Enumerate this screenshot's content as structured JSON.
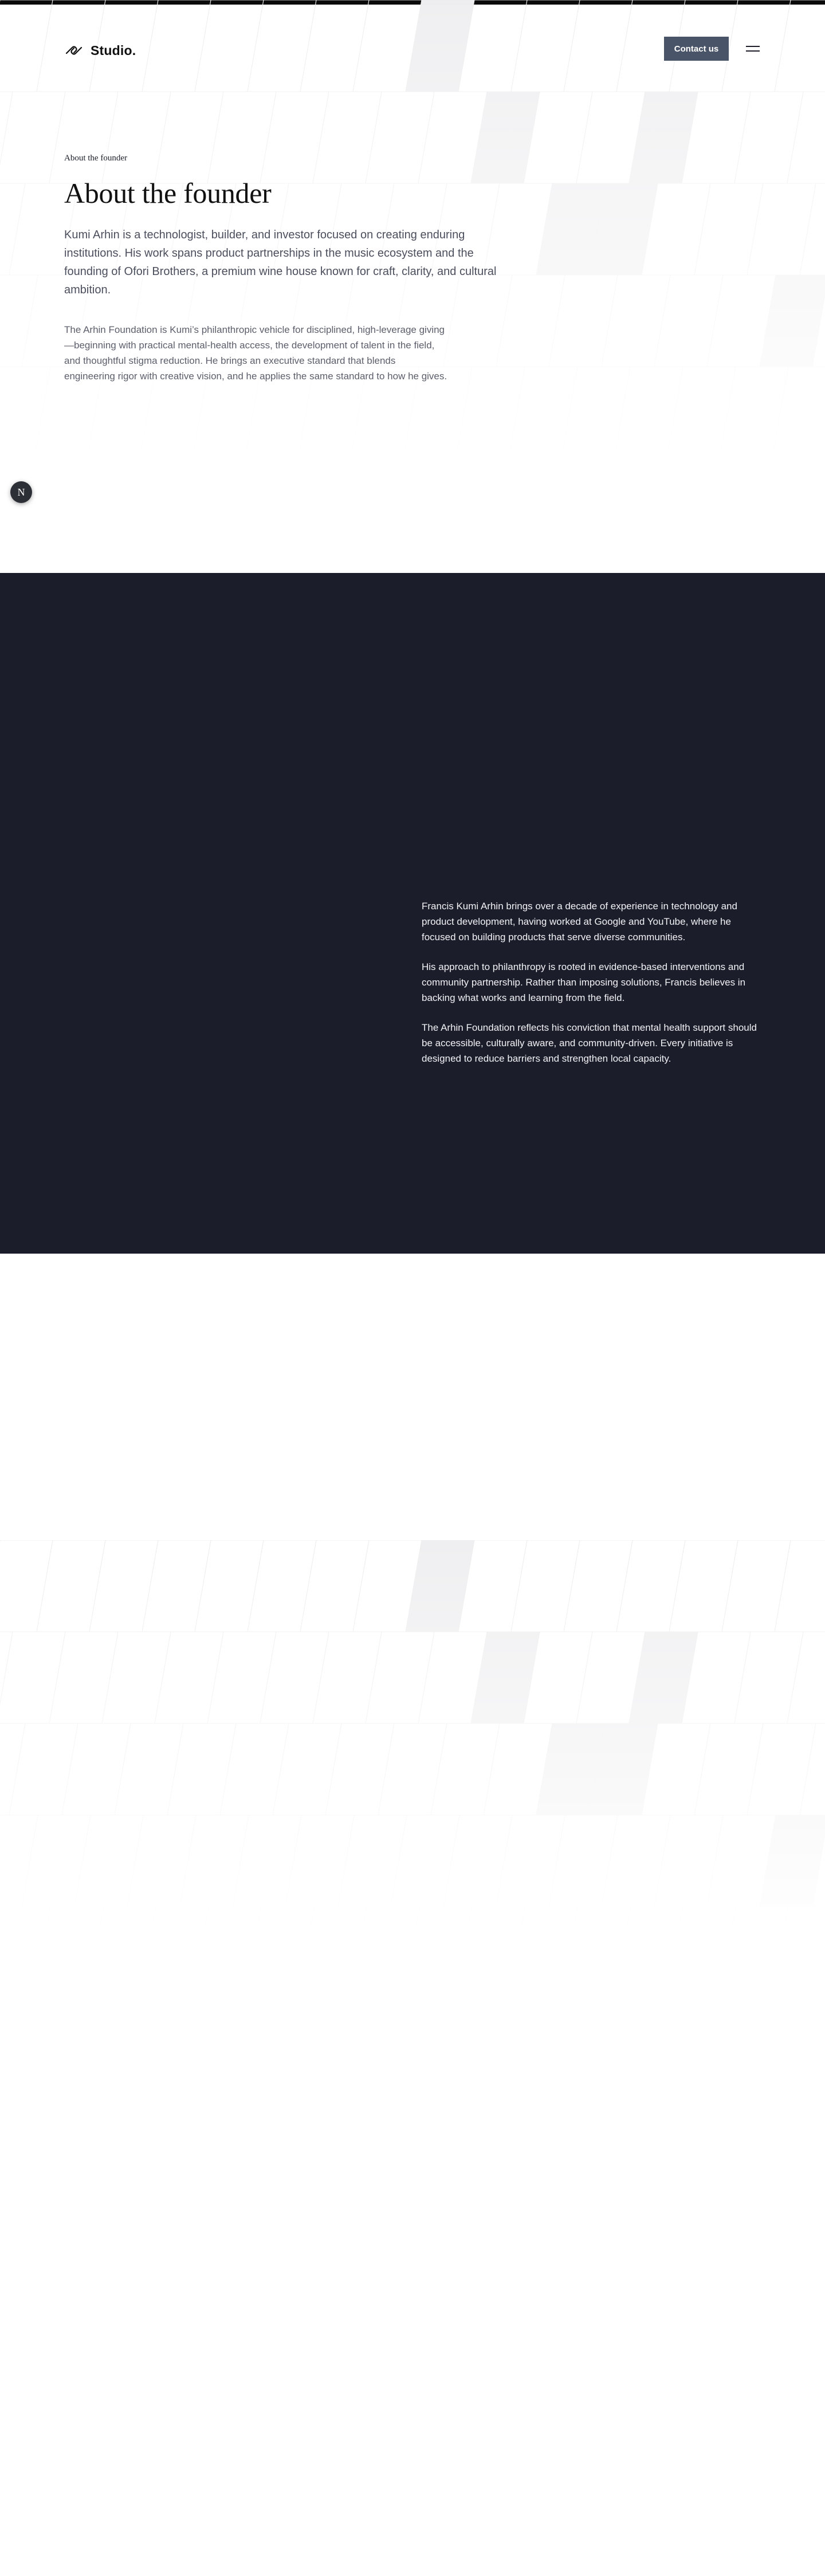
{
  "header": {
    "logo_text": "Studio.",
    "contact_label": "Contact us",
    "menu_icon": "hamburger-icon",
    "logo_icon": "link-icon"
  },
  "about": {
    "eyebrow": "About the founder",
    "title": "About the founder",
    "lead": "Kumi Arhin is a technologist, builder, and investor focused on creating enduring institutions. His work spans product partnerships in the music ecosystem and the founding of Ofori Brothers, a premium wine house known for craft, clarity, and cultural ambition.",
    "body": "The Arhin Foundation is Kumi’s philanthropic vehicle for disciplined, high-leverage giving—beginning with practical mental-health access, the development of talent in the field, and thoughtful stigma reduction. He brings an executive standard that blends engineering rigor with creative vision, and he applies the same standard to how he gives."
  },
  "floating_button": {
    "label": "N"
  },
  "dark_section": {
    "paragraphs": [
      "Francis Kumi Arhin brings over a decade of experience in technology and product development, having worked at Google and YouTube, where he focused on building products that serve diverse communities.",
      "His approach to philanthropy is rooted in evidence-based interventions and community partnership. Rather than imposing solutions, Francis believes in backing what works and learning from the field.",
      "The Arhin Foundation reflects his conviction that mental health support should be accessible, culturally aware, and community-driven. Every initiative is designed to reduce barriers and strengthen local capacity."
    ]
  },
  "colors": {
    "dark_background": "#1c1d2a",
    "button_background": "#4a5468",
    "text_primary": "#1c1d29",
    "text_muted": "#5b5e6a"
  }
}
